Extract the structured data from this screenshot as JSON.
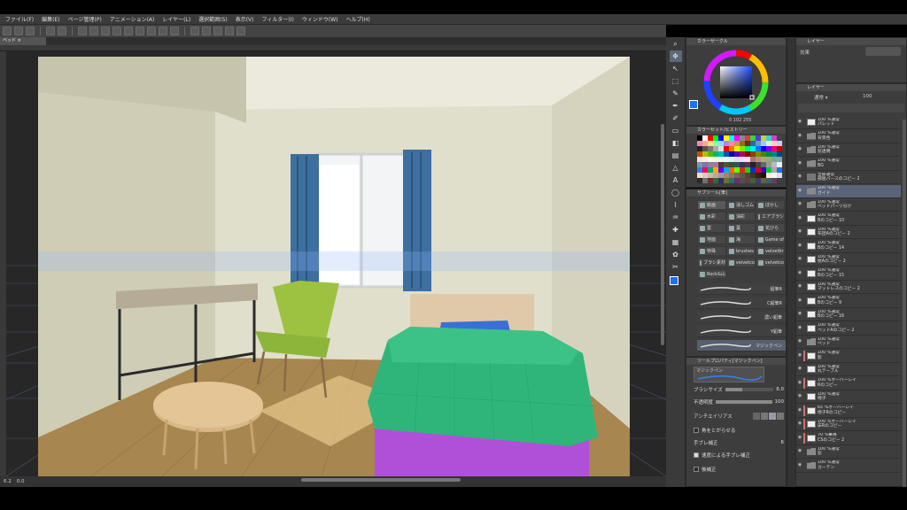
{
  "menu": [
    "ファイル(F)",
    "編集(E)",
    "ページ管理(P)",
    "アニメーション(A)",
    "レイヤー(L)",
    "選択範囲(S)",
    "表示(V)",
    "フィルター(I)",
    "ウィンドウ(W)",
    "ヘルプ(H)"
  ],
  "document_tab": "ベッド",
  "status": {
    "zoom": "6.2",
    "angle": "0.0"
  },
  "color_panel": {
    "title": "カラーサークル",
    "values": "0 102 255",
    "main_color": "#1a73e8"
  },
  "swatch_panel": {
    "title": "カラーセット/ヒストリー"
  },
  "subtool": {
    "title": "サブツール[筆]",
    "tabs": [
      "絵画",
      "消しゴム",
      "ぼかし",
      "水彩",
      "油彩",
      "エアブラシ",
      "雲",
      "葉",
      "花びら",
      "地面",
      "海",
      "Game of",
      "特殊",
      "brushes",
      "velvetbr",
      "ブラシ素材",
      "velvetco",
      "velvetco",
      "Rock&山"
    ],
    "brushes": [
      "鉛筆R",
      "C鉛筆R",
      "濃い鉛筆",
      "Y鉛筆",
      "マジックペン"
    ]
  },
  "tool_property": {
    "title": "ツールプロパティ[マジックペン]",
    "brush_name": "マジックペン",
    "brush_size_label": "ブラシサイズ",
    "brush_size": "8.0",
    "opacity_label": "不透明度",
    "opacity": "100",
    "opacity_fraction": 1.0,
    "size_fraction": 0.35,
    "antialias_label": "アンチエイリアス",
    "corner_label": "角をとがらせる",
    "stabilize_label": "手ブレ補正",
    "stabilize": "6",
    "speed_stabilize_label": "速度による手ブレ補正",
    "post_correct_label": "後補正"
  },
  "effect_panel": {
    "title": "レイヤー",
    "label": "効果"
  },
  "layer_panel": {
    "title": "レイヤー",
    "blend": "通常",
    "opacity": "100",
    "layers": [
      {
        "mode": "100 %通常",
        "name": "パレット",
        "kind": "layer",
        "tag": ""
      },
      {
        "mode": "100 %通常",
        "name": "背景色",
        "kind": "folder",
        "tag": ""
      },
      {
        "mode": "100 %通常",
        "name": "窓透明",
        "kind": "folder",
        "tag": ""
      },
      {
        "mode": "100 %通常",
        "name": "BG",
        "kind": "folder",
        "tag": ""
      },
      {
        "mode": "全部通常",
        "name": "部屋パースのコピー 2",
        "kind": "3d",
        "tag": ""
      },
      {
        "mode": "100 %通常",
        "name": "ガイド",
        "kind": "folder",
        "tag": "",
        "selected": true
      },
      {
        "mode": "100 %通常",
        "name": "ベッドパーツ分け",
        "kind": "folder",
        "tag": ""
      },
      {
        "mode": "100 %通常",
        "name": "Bのコピー 10",
        "kind": "layer",
        "tag": ""
      },
      {
        "mode": "100 %通常",
        "name": "布団Aのコピー 2",
        "kind": "layer",
        "tag": ""
      },
      {
        "mode": "100 %通常",
        "name": "Bのコピー 14",
        "kind": "layer",
        "tag": ""
      },
      {
        "mode": "100 %通常",
        "name": "枕Aのコピー 2",
        "kind": "layer",
        "tag": ""
      },
      {
        "mode": "100 %通常",
        "name": "Bのコピー 15",
        "kind": "layer",
        "tag": ""
      },
      {
        "mode": "100 %通常",
        "name": "マットレスのコピー 2",
        "kind": "layer",
        "tag": ""
      },
      {
        "mode": "100 %通常",
        "name": "Bのコピー 9",
        "kind": "layer",
        "tag": ""
      },
      {
        "mode": "100 %通常",
        "name": "Bのコピー 16",
        "kind": "layer",
        "tag": ""
      },
      {
        "mode": "100 %通常",
        "name": "ベッドAのコピー 2",
        "kind": "layer",
        "tag": ""
      },
      {
        "mode": "100 %通常",
        "name": "ベッド",
        "kind": "folder",
        "tag": ""
      },
      {
        "mode": "100 %通常",
        "name": "影",
        "kind": "layer",
        "tag": "#d07070"
      },
      {
        "mode": "100 %通常",
        "name": "丸テーブル",
        "kind": "layer",
        "tag": ""
      },
      {
        "mode": "100 %オーバーレイ",
        "name": "Rのコピー",
        "kind": "layer",
        "tag": "#d07070"
      },
      {
        "mode": "100 %通常",
        "name": "椅子",
        "kind": "layer",
        "tag": ""
      },
      {
        "mode": "65 %オーバーレイ",
        "name": "椅子Rのコピー",
        "kind": "layer",
        "tag": "#d07070"
      },
      {
        "mode": "100 %オーバーレイ",
        "name": "床Rのコピー",
        "kind": "layer",
        "tag": "#d07070"
      },
      {
        "mode": "70 %乗算",
        "name": "CSのコピー 2",
        "kind": "layer",
        "tag": "#d07070"
      },
      {
        "mode": "100 %通常",
        "name": "窓",
        "kind": "folder",
        "tag": ""
      },
      {
        "mode": "100 %通常",
        "name": "カーテン",
        "kind": "folder",
        "tag": ""
      }
    ]
  },
  "colors": {
    "accent": "#1a73e8",
    "ui_bg": "#3d3d3d",
    "bed_sheet": "#2fb57a",
    "bed_base": "#b050d8",
    "chair": "#8db53a",
    "curtain": "#3d6fa0",
    "pillow": "#3b6fd8"
  }
}
